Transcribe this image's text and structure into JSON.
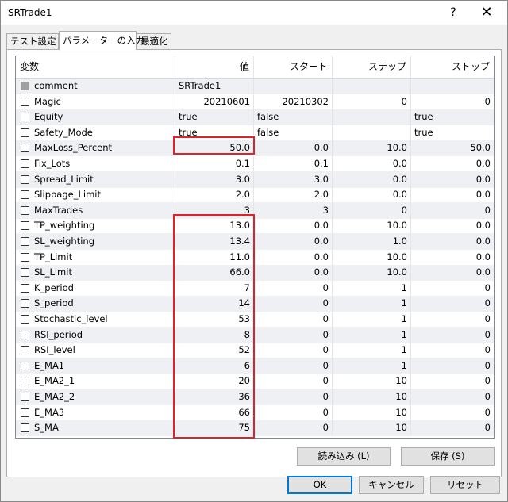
{
  "window": {
    "title": "SRTrade1",
    "help_label": "?",
    "close_label": "✕"
  },
  "tabs": [
    {
      "label": "テスト設定",
      "active": false
    },
    {
      "label": "パラメーターの入力",
      "active": true
    },
    {
      "label": "最適化",
      "active": false
    }
  ],
  "columns": [
    "変数",
    "値",
    "スタート",
    "ステップ",
    "ストップ"
  ],
  "rows": [
    {
      "name": "comment",
      "value": "SRTrade1",
      "start": "",
      "step": "",
      "stop": "",
      "checkbox": "disabled"
    },
    {
      "name": "Magic",
      "value": "20210601",
      "start": "20210302",
      "step": "0",
      "stop": "0",
      "checkbox": "unchecked"
    },
    {
      "name": "Equity",
      "value": "true",
      "start": "false",
      "step": "",
      "stop": "true",
      "checkbox": "unchecked"
    },
    {
      "name": "Safety_Mode",
      "value": "true",
      "start": "false",
      "step": "",
      "stop": "true",
      "checkbox": "unchecked"
    },
    {
      "name": "MaxLoss_Percent",
      "value": "50.0",
      "start": "0.0",
      "step": "10.0",
      "stop": "50.0",
      "checkbox": "unchecked"
    },
    {
      "name": "Fix_Lots",
      "value": "0.1",
      "start": "0.1",
      "step": "0.0",
      "stop": "0.0",
      "checkbox": "unchecked"
    },
    {
      "name": "Spread_Limit",
      "value": "3.0",
      "start": "3.0",
      "step": "0.0",
      "stop": "0.0",
      "checkbox": "unchecked"
    },
    {
      "name": "Slippage_Limit",
      "value": "2.0",
      "start": "2.0",
      "step": "0.0",
      "stop": "0.0",
      "checkbox": "unchecked"
    },
    {
      "name": "MaxTrades",
      "value": "3",
      "start": "3",
      "step": "0",
      "stop": "0",
      "checkbox": "unchecked"
    },
    {
      "name": "TP_weighting",
      "value": "13.0",
      "start": "0.0",
      "step": "10.0",
      "stop": "0.0",
      "checkbox": "unchecked"
    },
    {
      "name": "SL_weighting",
      "value": "13.4",
      "start": "0.0",
      "step": "1.0",
      "stop": "0.0",
      "checkbox": "unchecked"
    },
    {
      "name": "TP_Limit",
      "value": "11.0",
      "start": "0.0",
      "step": "10.0",
      "stop": "0.0",
      "checkbox": "unchecked"
    },
    {
      "name": "SL_Limit",
      "value": "66.0",
      "start": "0.0",
      "step": "10.0",
      "stop": "0.0",
      "checkbox": "unchecked"
    },
    {
      "name": "K_period",
      "value": "7",
      "start": "0",
      "step": "1",
      "stop": "0",
      "checkbox": "unchecked"
    },
    {
      "name": "S_period",
      "value": "14",
      "start": "0",
      "step": "1",
      "stop": "0",
      "checkbox": "unchecked"
    },
    {
      "name": "Stochastic_level",
      "value": "53",
      "start": "0",
      "step": "1",
      "stop": "0",
      "checkbox": "unchecked"
    },
    {
      "name": "RSI_period",
      "value": "8",
      "start": "0",
      "step": "1",
      "stop": "0",
      "checkbox": "unchecked"
    },
    {
      "name": "RSI_level",
      "value": "52",
      "start": "0",
      "step": "1",
      "stop": "0",
      "checkbox": "unchecked"
    },
    {
      "name": "E_MA1",
      "value": "6",
      "start": "0",
      "step": "1",
      "stop": "0",
      "checkbox": "unchecked"
    },
    {
      "name": "E_MA2_1",
      "value": "20",
      "start": "0",
      "step": "10",
      "stop": "0",
      "checkbox": "unchecked"
    },
    {
      "name": "E_MA2_2",
      "value": "36",
      "start": "0",
      "step": "10",
      "stop": "0",
      "checkbox": "unchecked"
    },
    {
      "name": "E_MA3",
      "value": "66",
      "start": "0",
      "step": "10",
      "stop": "0",
      "checkbox": "unchecked"
    },
    {
      "name": "S_MA",
      "value": "75",
      "start": "0",
      "step": "10",
      "stop": "0",
      "checkbox": "unchecked"
    }
  ],
  "highlight_color": "#e0202a",
  "buttons": {
    "load": "読み込み (L)",
    "save": "保存 (S)",
    "ok": "OK",
    "cancel": "キャンセル",
    "reset": "リセット"
  }
}
